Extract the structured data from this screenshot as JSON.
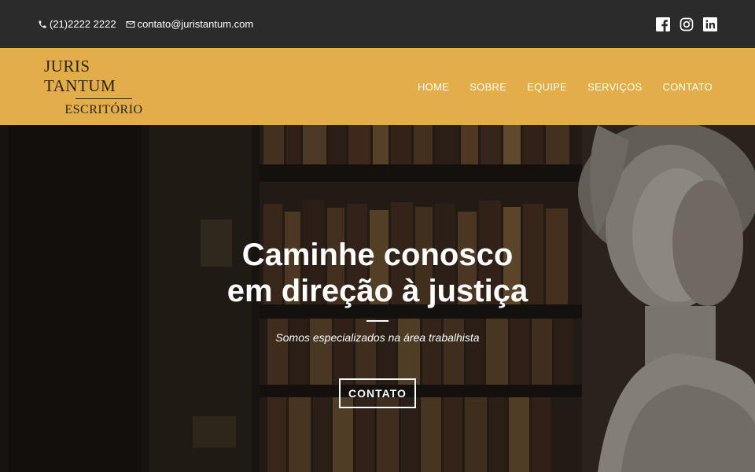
{
  "topbar": {
    "phone": "(21)2222 2222",
    "email": "contato@juristantum.com",
    "social_icons": [
      "facebook-icon",
      "instagram-icon",
      "linkedin-icon"
    ]
  },
  "logo": {
    "title": "JURIS TANTUM",
    "subtitle": "ESCRITÓRIO"
  },
  "nav": {
    "items": [
      "HOME",
      "SOBRE",
      "EQUIPE",
      "SERVIÇOS",
      "CONTATO"
    ]
  },
  "hero": {
    "title_line1": "Caminhe conosco",
    "title_line2": "em direção à justiça",
    "subtitle": "Somos especializados na área trabalhista",
    "button": "CONTATO"
  },
  "colors": {
    "topbar": "#2b2b2b",
    "nav": "#e3ad4a",
    "text_light": "#ffffff"
  }
}
